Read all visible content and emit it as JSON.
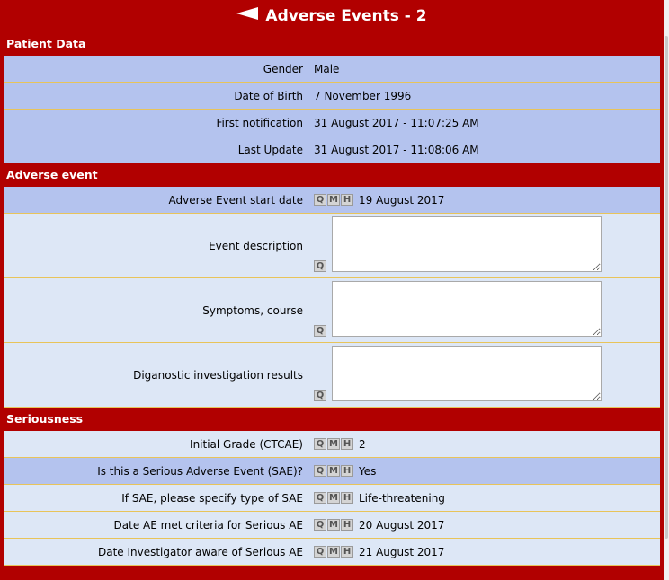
{
  "title": "Adverse Events - 2",
  "sections": {
    "patient": "Patient Data",
    "adverse": "Adverse event",
    "seriousness": "Seriousness"
  },
  "buttons": {
    "q": "Q",
    "m": "M",
    "h": "H"
  },
  "patient": {
    "gender_label": "Gender",
    "gender_value": "Male",
    "dob_label": "Date of Birth",
    "dob_value": "7 November 1996",
    "first_label": "First notification",
    "first_value": "31 August 2017 - 11:07:25 AM",
    "last_label": "Last Update",
    "last_value": "31 August 2017 - 11:08:06 AM"
  },
  "adverse": {
    "start_label": "Adverse Event start date",
    "start_value": "19 August 2017",
    "desc_label": "Event description",
    "symptoms_label": "Symptoms, course",
    "diag_label": "Diganostic investigation results"
  },
  "seriousness": {
    "grade_label": "Initial Grade (CTCAE)",
    "grade_value": "2",
    "sae_label": "Is this a Serious Adverse Event (SAE)?",
    "sae_value": "Yes",
    "type_label": "If SAE, please specify type of SAE",
    "type_value": "Life-threatening",
    "met_label": "Date AE met criteria for Serious AE",
    "met_value": "20 August 2017",
    "aware_label": "Date Investigator aware of Serious AE",
    "aware_value": "21 August 2017"
  },
  "colors": {
    "frame": "#b10000",
    "row_dark": "#b4c3ee",
    "row_light": "#dde7f6",
    "row_border": "#e8c45a"
  },
  "icons": {
    "back": "back-arrow-icon"
  }
}
